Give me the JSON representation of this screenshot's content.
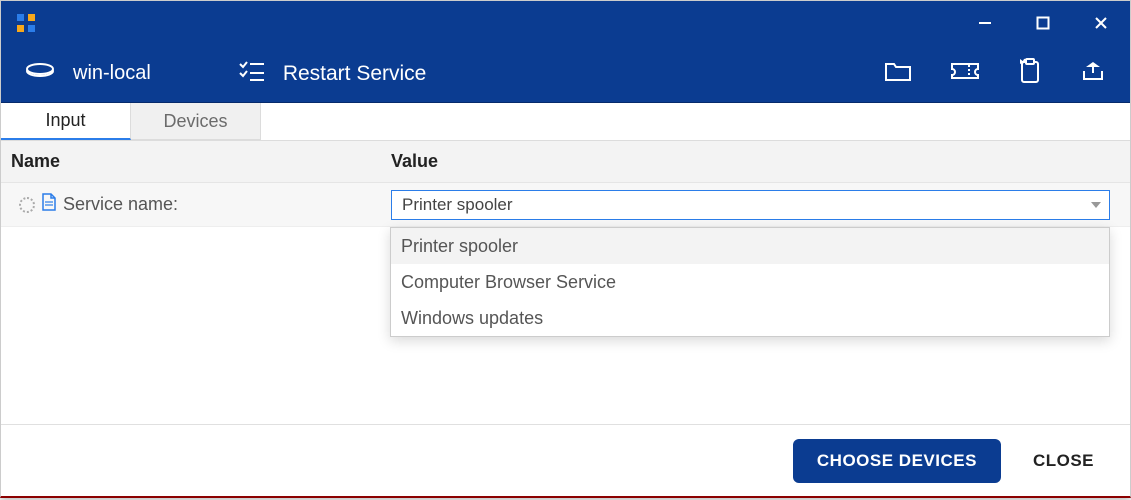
{
  "titlebar": {},
  "toolbar": {
    "device_name": "win-local",
    "action_title": "Restart Service"
  },
  "tabs": [
    {
      "label": "Input",
      "active": true
    },
    {
      "label": "Devices",
      "active": false
    }
  ],
  "grid": {
    "headers": {
      "name": "Name",
      "value": "Value"
    },
    "row": {
      "label": "Service name:",
      "selected": "Printer spooler"
    }
  },
  "dropdown": {
    "options": [
      "Printer spooler",
      "Computer Browser Service",
      "Windows updates"
    ]
  },
  "footer": {
    "primary": "CHOOSE DEVICES",
    "secondary": "CLOSE"
  }
}
